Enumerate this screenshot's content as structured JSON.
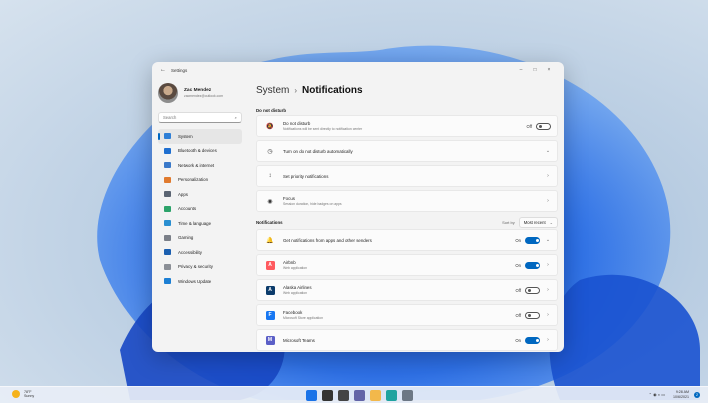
{
  "window": {
    "title": "Settings",
    "controls": {
      "minimize": "–",
      "maximize": "□",
      "close": "×"
    }
  },
  "profile": {
    "name": "Zac Mendez",
    "email": "zacmendez@outlook.com"
  },
  "search": {
    "placeholder": "Search"
  },
  "sidebar": {
    "items": [
      {
        "label": "System",
        "icon": "monitor-icon",
        "color": "#2f7fd6"
      },
      {
        "label": "Bluetooth & devices",
        "icon": "bluetooth-icon",
        "color": "#1f6fd0"
      },
      {
        "label": "Network & internet",
        "icon": "wifi-icon",
        "color": "#3a79c9"
      },
      {
        "label": "Personalization",
        "icon": "brush-icon",
        "color": "#e07a2e"
      },
      {
        "label": "Apps",
        "icon": "apps-icon",
        "color": "#5a6472"
      },
      {
        "label": "Accounts",
        "icon": "person-icon",
        "color": "#2ca36a"
      },
      {
        "label": "Time & language",
        "icon": "globe-icon",
        "color": "#2a8fd1"
      },
      {
        "label": "Gaming",
        "icon": "gamepad-icon",
        "color": "#7a7f88"
      },
      {
        "label": "Accessibility",
        "icon": "accessibility-icon",
        "color": "#1b5fb0"
      },
      {
        "label": "Privacy & security",
        "icon": "shield-icon",
        "color": "#8b8f96"
      },
      {
        "label": "Windows Update",
        "icon": "update-icon",
        "color": "#1c7fd4"
      }
    ]
  },
  "breadcrumb": {
    "parent": "System",
    "separator": "›",
    "current": "Notifications"
  },
  "dnd": {
    "section_label": "Do not disturb",
    "cards": [
      {
        "title": "Do not disturb",
        "subtitle": "Notifications will be sent directly to notification center",
        "icon": "bell-zz-icon",
        "state": "Off"
      },
      {
        "title": "Turn on do not disturb automatically",
        "subtitle": "",
        "icon": "clock-icon"
      },
      {
        "title": "Set priority notifications",
        "subtitle": "",
        "icon": "priority-icon"
      },
      {
        "title": "Focus",
        "subtitle": "Session duration, hide badges on apps",
        "icon": "focus-icon"
      }
    ]
  },
  "notifications": {
    "section_label": "Notifications",
    "sort_label": "Sort by",
    "sort_value": "Most recent",
    "cards": [
      {
        "title": "Get notifications from apps and other senders",
        "subtitle": "",
        "icon": "bell-icon",
        "state": "On"
      },
      {
        "title": "Airbnb",
        "subtitle": "Web application",
        "icon": "airbnb-icon",
        "color": "#ff5a5f",
        "state": "On"
      },
      {
        "title": "Alaska Airlines",
        "subtitle": "Web application",
        "icon": "alaska-airlines-icon",
        "color": "#0b3b6b",
        "state": "Off"
      },
      {
        "title": "Facebook",
        "subtitle": "Microsoft Store application",
        "icon": "facebook-icon",
        "color": "#1877f2",
        "state": "Off"
      },
      {
        "title": "Microsoft Teams",
        "subtitle": "",
        "icon": "teams-icon",
        "color": "#5b5fc7",
        "state": "On"
      }
    ]
  },
  "taskbar": {
    "weather": {
      "temp": "78°F",
      "condition": "Sunny"
    },
    "apps": [
      "windows-start-icon",
      "search-icon",
      "task-view-icon",
      "chat-icon",
      "file-explorer-icon",
      "edge-icon",
      "settings-icon"
    ],
    "time": "9:28 AM",
    "date": "10/6/2021",
    "notification_count": "2"
  }
}
